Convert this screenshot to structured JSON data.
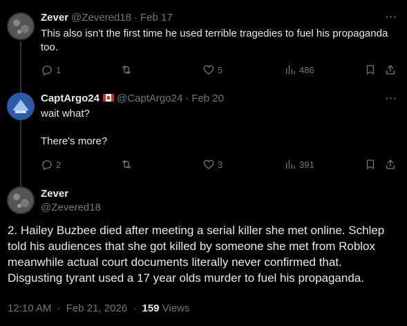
{
  "replies": [
    {
      "name": "Zever",
      "handle": "@Zevered18",
      "date": "Feb 17",
      "text": "This also isn't the first time he used terrible tragedies to fuel his propaganda too.",
      "replies": "1",
      "reposts": "",
      "likes": "5",
      "views": "486",
      "flag": false
    },
    {
      "name": "CaptArgo24",
      "handle": "@CaptArgo24",
      "date": "Feb 20",
      "text": "wait what?\n\nThere's more?",
      "replies": "2",
      "reposts": "",
      "likes": "3",
      "views": "391",
      "flag": true
    }
  ],
  "main": {
    "name": "Zever",
    "handle": "@Zevered18",
    "text": "2. Hailey Buzbee died after meeting a serial killer she met online. Schlep told his audiences that she got killed by someone she met from Roblox meanwhile actual court documents literally never confirmed that. Disgusting tyrant used a 17 year olds murder to fuel his propaganda.",
    "time": "12:10 AM",
    "date": "Feb 21, 2026",
    "views_count": "159",
    "views_label": "Views"
  },
  "ui": {
    "more": "···",
    "separator": "·"
  }
}
